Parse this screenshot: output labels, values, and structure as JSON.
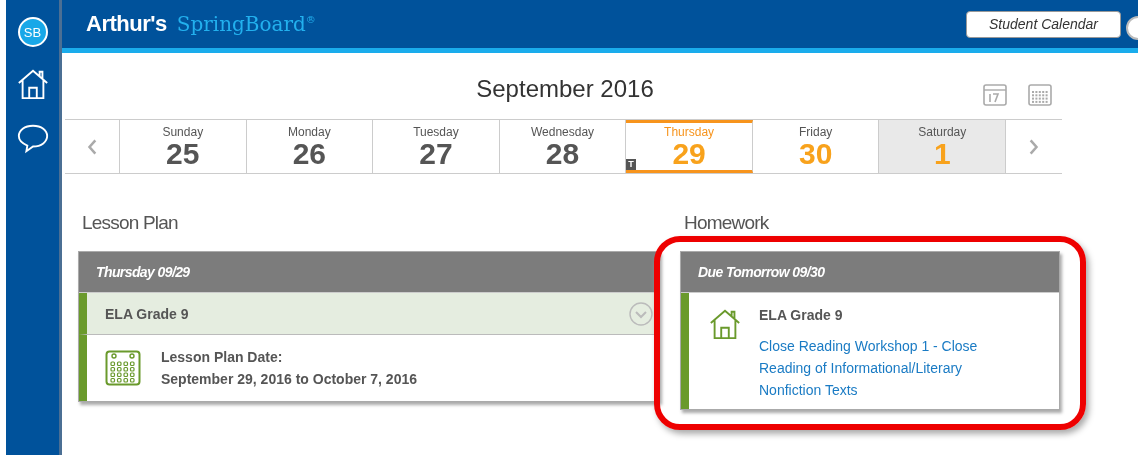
{
  "sidebar": {
    "logo": "SB",
    "items": [
      {
        "kind": "home"
      },
      {
        "kind": "chat"
      }
    ]
  },
  "header": {
    "name": "Arthur's",
    "product": "SpringBoard$^{®}$",
    "button": "Student Calendar"
  },
  "calendar": {
    "month": "September 2016",
    "days": [
      {
        "weekday": "Sunday",
        "day": "25",
        "selected": false,
        "accent": false,
        "other_month": false
      },
      {
        "weekday": "Monday",
        "day": "26",
        "selected": false,
        "accent": false,
        "other_month": false
      },
      {
        "weekday": "Tuesday",
        "day": "27",
        "selected": false,
        "accent": false,
        "other_month": false
      },
      {
        "weekday": "Wednesday",
        "day": "28",
        "selected": false,
        "accent": false,
        "other_month": false
      },
      {
        "weekday": "Thursday",
        "day": "29",
        "selected": true,
        "accent": true,
        "other_month": false,
        "badge": "T"
      },
      {
        "weekday": "Friday",
        "day": "30",
        "selected": false,
        "accent": true,
        "other_month": false
      },
      {
        "weekday": "Saturday",
        "day": "1",
        "selected": false,
        "accent": true,
        "other_month": true
      }
    ]
  },
  "lesson_plan": {
    "title": "Lesson Plan",
    "header": "Thursday 09/29",
    "course": "ELA Grade 9",
    "expanded": false,
    "date_label": "Lesson Plan Date:",
    "date_range": "September 29, 2016 to October 7, 2016"
  },
  "homework": {
    "title": "Homework",
    "header": "Due Tomorrow 09/30",
    "course": "ELA Grade 9",
    "link": "Close Reading Workshop 1 - Close Reading of Informational/Literary Nonfiction Texts",
    "highlighted": true
  }
}
